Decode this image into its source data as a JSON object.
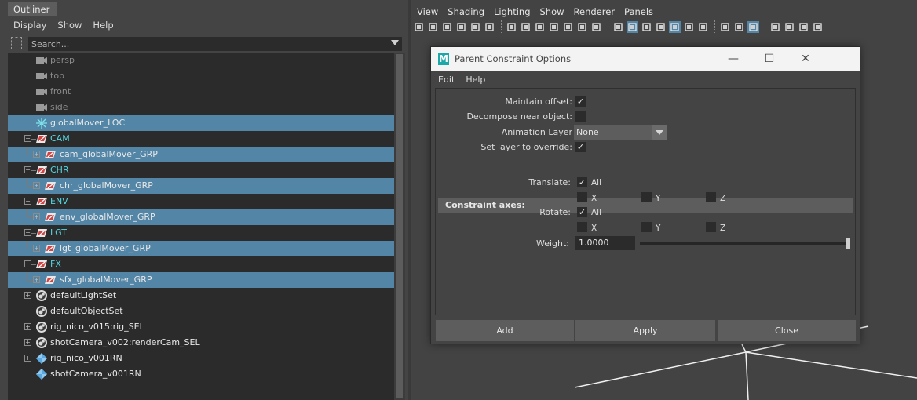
{
  "outliner": {
    "title": "Outliner",
    "menu": [
      "Display",
      "Show",
      "Help"
    ],
    "search_placeholder": "Search...",
    "items": [
      {
        "label": "persp",
        "icon": "camera-icon",
        "indent": 1,
        "selected": false,
        "dim": true,
        "expander": "",
        "color": "dim"
      },
      {
        "label": "top",
        "icon": "camera-icon",
        "indent": 1,
        "selected": false,
        "dim": true,
        "expander": "",
        "color": "dim"
      },
      {
        "label": "front",
        "icon": "camera-icon",
        "indent": 1,
        "selected": false,
        "dim": true,
        "expander": "",
        "color": "dim"
      },
      {
        "label": "side",
        "icon": "camera-icon",
        "indent": 1,
        "selected": false,
        "dim": true,
        "expander": "",
        "color": "dim"
      },
      {
        "label": "globalMover_LOC",
        "icon": "locator-icon",
        "indent": 1,
        "selected": true,
        "dim": false,
        "expander": "",
        "color": "white"
      },
      {
        "label": "CAM",
        "icon": "group-icon",
        "indent": 1,
        "selected": false,
        "dim": false,
        "expander": "minus",
        "color": "cyan"
      },
      {
        "label": "cam_globalMover_GRP",
        "icon": "group-icon",
        "indent": 2,
        "selected": true,
        "dim": false,
        "expander": "plus",
        "color": "white"
      },
      {
        "label": "CHR",
        "icon": "group-icon",
        "indent": 1,
        "selected": false,
        "dim": false,
        "expander": "minus",
        "color": "cyan"
      },
      {
        "label": "chr_globalMover_GRP",
        "icon": "group-icon",
        "indent": 2,
        "selected": true,
        "dim": false,
        "expander": "plus",
        "color": "white"
      },
      {
        "label": "ENV",
        "icon": "group-icon",
        "indent": 1,
        "selected": false,
        "dim": false,
        "expander": "minus",
        "color": "cyan"
      },
      {
        "label": "env_globalMover_GRP",
        "icon": "group-icon",
        "indent": 2,
        "selected": true,
        "dim": false,
        "expander": "plus",
        "color": "white"
      },
      {
        "label": "LGT",
        "icon": "group-icon",
        "indent": 1,
        "selected": false,
        "dim": false,
        "expander": "minus",
        "color": "cyan"
      },
      {
        "label": "lgt_globalMover_GRP",
        "icon": "group-icon",
        "indent": 2,
        "selected": true,
        "dim": false,
        "expander": "plus",
        "color": "white"
      },
      {
        "label": "FX",
        "icon": "group-icon",
        "indent": 1,
        "selected": false,
        "dim": false,
        "expander": "minus",
        "color": "cyan"
      },
      {
        "label": "sfx_globalMover_GRP",
        "icon": "group-icon",
        "indent": 2,
        "selected": true,
        "dim": false,
        "expander": "plus",
        "color": "white"
      },
      {
        "label": "defaultLightSet",
        "icon": "set-icon",
        "indent": 0,
        "selected": false,
        "dim": false,
        "expander": "plus",
        "color": "white"
      },
      {
        "label": "defaultObjectSet",
        "icon": "set-icon",
        "indent": 0,
        "selected": false,
        "dim": false,
        "expander": "",
        "color": "white"
      },
      {
        "label": "rig_nico_v015:rig_SEL",
        "icon": "set-icon",
        "indent": 0,
        "selected": false,
        "dim": false,
        "expander": "plus",
        "color": "white"
      },
      {
        "label": "shotCamera_v002:renderCam_SEL",
        "icon": "set-icon",
        "indent": 0,
        "selected": false,
        "dim": false,
        "expander": "plus",
        "color": "white"
      },
      {
        "label": "rig_nico_v001RN",
        "icon": "reference-icon",
        "indent": 0,
        "selected": false,
        "dim": false,
        "expander": "plus",
        "color": "white"
      },
      {
        "label": "shotCamera_v001RN",
        "icon": "reference-icon",
        "indent": 0,
        "selected": false,
        "dim": false,
        "expander": "",
        "color": "white"
      }
    ]
  },
  "viewport": {
    "menu": [
      "View",
      "Shading",
      "Lighting",
      "Show",
      "Renderer",
      "Panels"
    ]
  },
  "dialog": {
    "title": "Parent Constraint Options",
    "menu": [
      "Edit",
      "Help"
    ],
    "maintain_offset_label": "Maintain offset:",
    "maintain_offset_checked": true,
    "decompose_label": "Decompose near object:",
    "decompose_checked": false,
    "animation_layer_label": "Animation Layer",
    "animation_layer_value": "None",
    "set_layer_label": "Set layer to override:",
    "set_layer_checked": true,
    "constraint_axes_header": "Constraint axes:",
    "translate_label": "Translate:",
    "translate_all_label": "All",
    "translate_all_checked": true,
    "rotate_label": "Rotate:",
    "rotate_all_label": "All",
    "rotate_all_checked": true,
    "axis_x": "X",
    "axis_y": "Y",
    "axis_z": "Z",
    "weight_label": "Weight:",
    "weight_value": "1.0000",
    "weight_fraction": 1.0,
    "buttons": {
      "add": "Add",
      "apply": "Apply",
      "close": "Close"
    },
    "window_controls": {
      "minimize": "—",
      "maximize": "☐",
      "close": "✕"
    }
  },
  "colors": {
    "selection": "#5285a6",
    "group_label": "#52d6e0",
    "maya_logo": "#1aa8a8"
  }
}
